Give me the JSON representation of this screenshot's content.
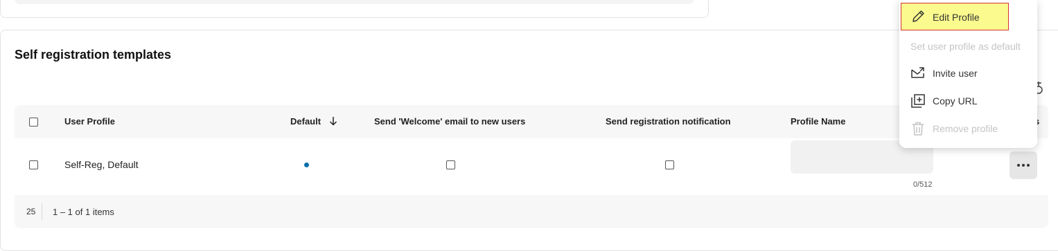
{
  "section": {
    "title": "Self registration templates"
  },
  "table": {
    "headers": {
      "user_profile": "User Profile",
      "default": "Default",
      "welcome_email": "Send 'Welcome' email to new users",
      "registration_notification": "Send registration notification",
      "profile_name": "Profile Name",
      "actions_partial": "s"
    },
    "rows": [
      {
        "user_profile": "Self-Reg, Default",
        "is_default": true,
        "welcome_email": false,
        "registration_notification": false,
        "profile_name": "",
        "char_counter": "0/512"
      }
    ]
  },
  "footer": {
    "page_size": "25",
    "items_info": "1 – 1 of 1 items"
  },
  "context_menu": {
    "items": [
      {
        "label": "Edit Profile",
        "icon": "pencil-icon",
        "disabled": false,
        "highlighted": true
      },
      {
        "label": "Set user profile as default",
        "icon": null,
        "disabled": true
      },
      {
        "label": "Invite user",
        "icon": "envelope-icon",
        "disabled": false
      },
      {
        "label": "Copy URL",
        "icon": "copy-icon",
        "disabled": false
      },
      {
        "label": "Remove profile",
        "icon": "trash-icon",
        "disabled": true
      }
    ]
  },
  "colors": {
    "default_dot": "#0a6fa8",
    "highlight_bg": "#fafa8e",
    "highlight_border": "#d62f2f"
  }
}
